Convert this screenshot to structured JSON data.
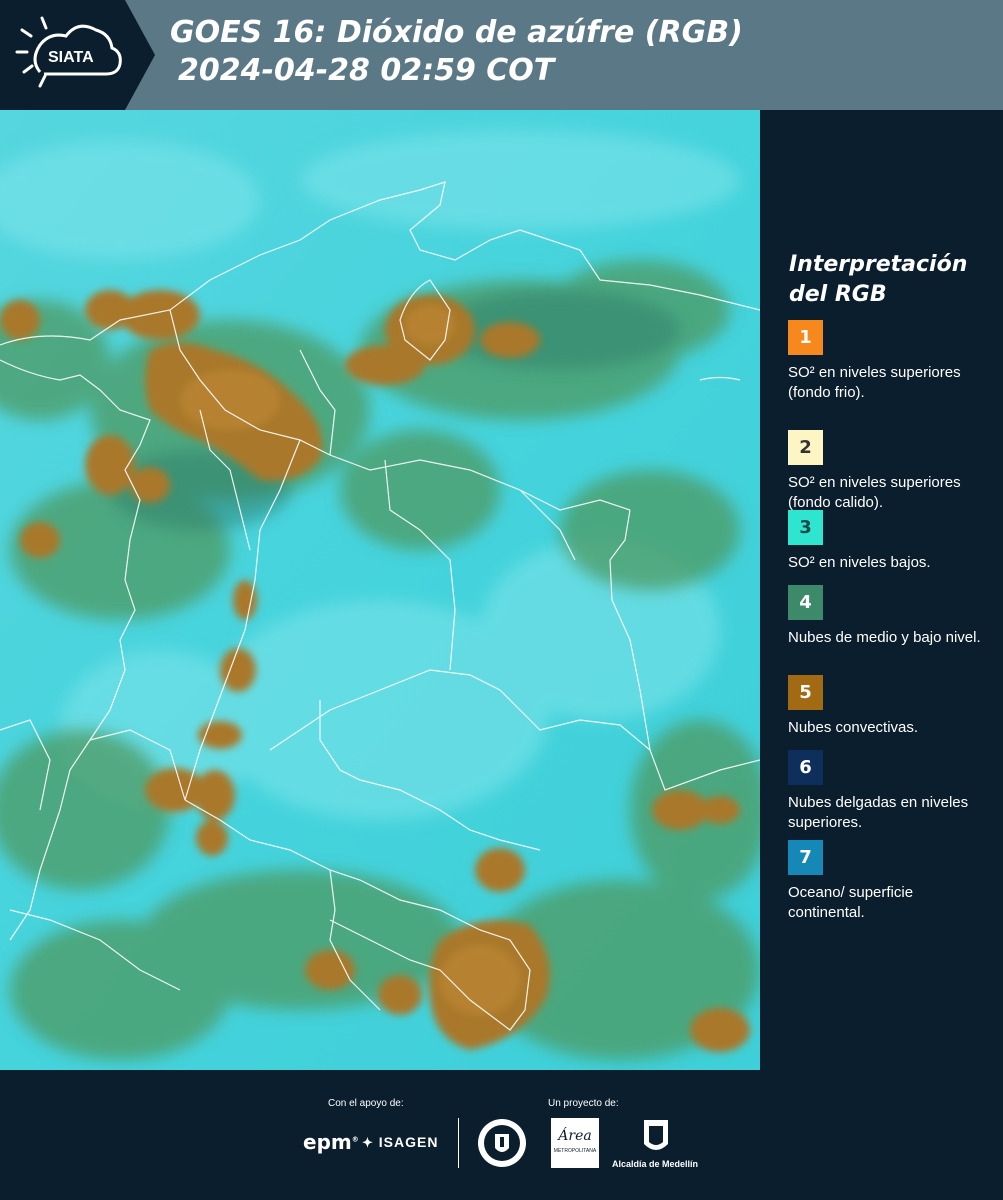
{
  "header": {
    "logo_text": "SIATA",
    "title_line1": "GOES 16: Dióxido de azúfre (RGB)",
    "title_line2": "2024-04-28 02:59 COT"
  },
  "legend": {
    "title_line1": "Interpretación",
    "title_line2": "del RGB",
    "items": [
      {
        "number": "1",
        "label": "SO² en niveles superiores (fondo frio).",
        "color": "#f7881e",
        "text_color": "#ffffff"
      },
      {
        "number": "2",
        "label": "SO² en niveles superiores (fondo calido).",
        "color": "#fdf6c4",
        "text_color": "#333333"
      },
      {
        "number": "3",
        "label": "SO² en niveles bajos.",
        "color": "#2ee6cf",
        "text_color": "#1c4a4a"
      },
      {
        "number": "4",
        "label": "Nubes de medio y bajo nivel.",
        "color": "#3d8a6a",
        "text_color": "#ffffff"
      },
      {
        "number": "5",
        "label": "Nubes convectivas.",
        "color": "#a36a14",
        "text_color": "#ffffff"
      },
      {
        "number": "6",
        "label": "Nubes delgadas en niveles superiores.",
        "color": "#0e2e5c",
        "text_color": "#ffffff"
      },
      {
        "number": "7",
        "label": "Oceano/ superficie continental.",
        "color": "#1688b8",
        "text_color": "#ffffff"
      }
    ]
  },
  "footer": {
    "support_label": "Con el apoyo de:",
    "project_label": "Un proyecto de:",
    "logos": [
      "epm",
      "ISAGEN",
      "Área Metropolitana Valle de Aburrá",
      "Alcaldía de Medellín"
    ],
    "epm_text": "epm",
    "isagen_text": "ISAGEN",
    "area_text": "Área",
    "area_sub": "METROPOLITANA",
    "alcaldia_text": "Alcaldía de Medellín"
  },
  "colors": {
    "header_bg": "#5a7886",
    "sidebar_bg": "#0b1e2d",
    "map_sky": "#3fd6de",
    "map_cloud_low": "#4f9a64",
    "map_convective": "#a7782e"
  }
}
